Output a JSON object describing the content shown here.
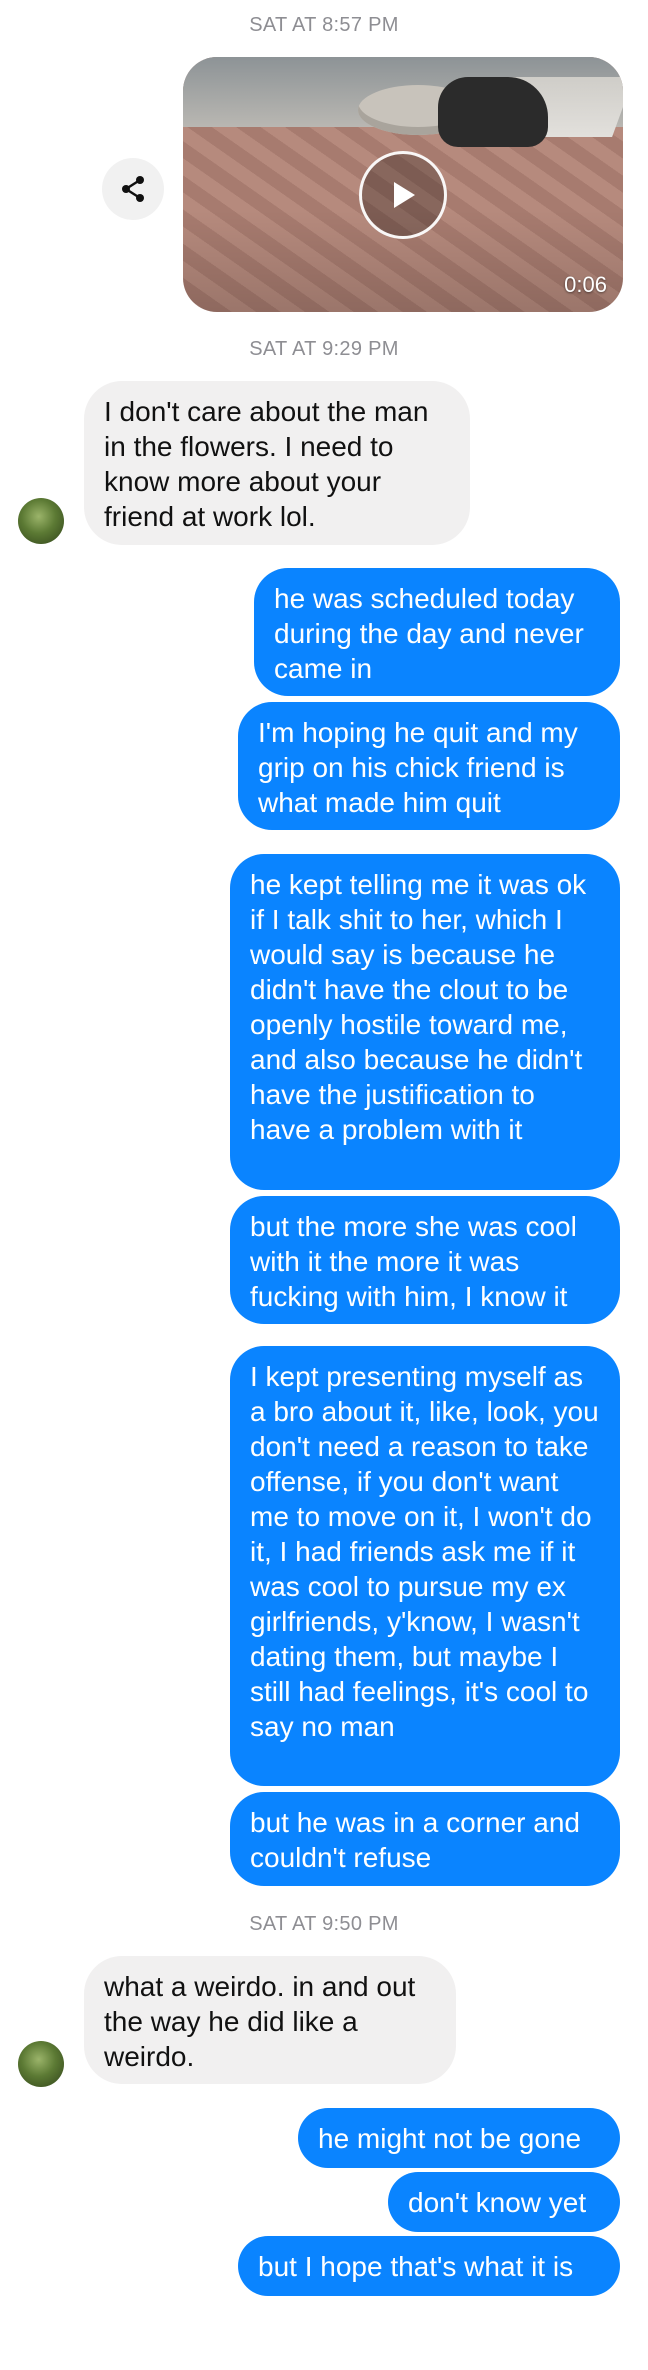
{
  "timestamps": [
    "SAT AT 8:57 PM",
    "SAT AT 9:29 PM",
    "SAT AT 9:50 PM"
  ],
  "video": {
    "duration": "0:06"
  },
  "icons": {
    "share": "share-icon",
    "play": "play-icon"
  },
  "colors": {
    "outgoing": "#0a84ff",
    "incoming": "#f1f0f0",
    "timestamp": "#8e8e93"
  },
  "messages": [
    {
      "dir": "in",
      "text": "I don't care about the man in the flowers. I need to know more about your friend at work lol."
    },
    {
      "dir": "out",
      "text": "he was scheduled today during the day and never came in"
    },
    {
      "dir": "out",
      "text": "I'm hoping he quit and my grip on his chick friend is what made him quit"
    },
    {
      "dir": "out",
      "text": "he kept telling me it was ok if I talk shit to her, which I would say is because he didn't have the clout to be openly hostile toward me, and also because he didn't have the justification to have a problem with it"
    },
    {
      "dir": "out",
      "text": "but the more she was cool with it the more it was fucking with him, I know it"
    },
    {
      "dir": "out",
      "text": "I kept presenting myself as a bro about it, like, look, you don't need a reason to take offense, if you don't want me to move on it, I won't do it, I had friends ask me if it was cool to pursue my ex girlfriends, y'know, I wasn't dating them, but maybe I still had feelings, it's cool to say no man"
    },
    {
      "dir": "out",
      "text": "but he was in a corner and couldn't refuse"
    },
    {
      "dir": "in",
      "text": "what a weirdo. in and out the way he did like a weirdo."
    },
    {
      "dir": "out",
      "text": "he might not be gone"
    },
    {
      "dir": "out",
      "text": "don't know yet"
    },
    {
      "dir": "out",
      "text": "but I hope that's what it is"
    }
  ]
}
